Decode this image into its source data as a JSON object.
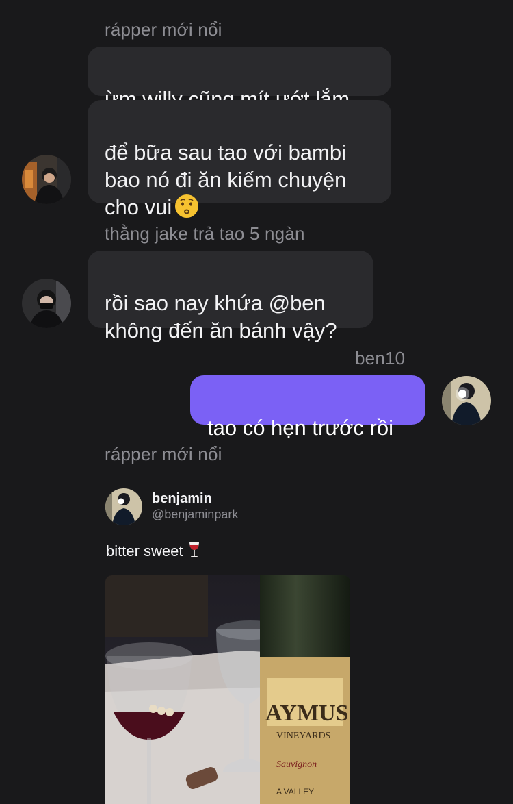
{
  "messages": [
    {
      "sender": "rápper mới nổi",
      "bubbles": [
        "ừm willy cũng mít ướt lắm",
        "để bữa sau tao với bambi\nbao nó đi ăn kiếm chuyện\ncho vui"
      ],
      "avatar_icon": "person-photo"
    },
    {
      "sender": "thằng jake trả tao 5 ngàn",
      "bubbles": [
        "rồi sao nay khứa @ben\nkhông đến ăn bánh vậy?"
      ],
      "avatar_icon": "person-masked-photo"
    },
    {
      "sender": "ben10",
      "bubbles": [
        "tao có hẹn trước rồi"
      ],
      "avatar_icon": "person-flash-photo"
    },
    {
      "sender": "rápper mới nổi",
      "shared_post": {
        "name": "benjamin",
        "handle": "@benjaminpark",
        "text": "bitter sweet",
        "text_emoji": "wine-glass-icon",
        "image_icon": "wine-bottle-photo"
      }
    }
  ],
  "colors": {
    "background": "#19191b",
    "incoming_bubble": "#2a2a2d",
    "outgoing_bubble": "#7b61f5",
    "sender_label": "#8d8d93"
  }
}
